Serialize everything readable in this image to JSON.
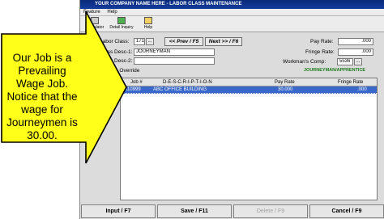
{
  "window": {
    "title": "YOUR COMPANY NAME HERE  -  LABOR CLASS MAINTENANCE"
  },
  "menu": [
    "Feature",
    "Help"
  ],
  "toolbar": [
    {
      "label": "Calculator",
      "icon": "calculator-icon"
    },
    {
      "label": "Detail Inquiry",
      "icon": "detail-inquiry-icon"
    },
    {
      "label": "Help",
      "icon": "help-icon"
    }
  ],
  "form": {
    "labor_class_label": "Labor Class:",
    "labor_class_value": "171",
    "lookup_button": "...",
    "prev_button": "<< Prev / F5",
    "next_button": "Next >> / F6",
    "desc1_label": "Class Desc-1:",
    "desc1_value": "JOURNEYMAN",
    "desc2_label": "Class Desc-2:",
    "desc2_value": "",
    "force_override_label": "Force Override",
    "pay_rate_label": "Pay Rate:",
    "pay_rate_value": ".000",
    "fringe_rate_label": "Fringe Rate:",
    "fringe_rate_value": ".000",
    "workmans_comp_label": "Workman's Comp:",
    "workmans_comp_value": "5536",
    "workmans_comp_button": "...",
    "category": "JOURNEYMAN/APPRENTICE"
  },
  "grid": {
    "columns": [
      "Job #",
      "D-E-S-C-R-I-P-T-I-O-N",
      "Pay Rate",
      "Fringe Rate"
    ],
    "rows": [
      {
        "job": "A10999",
        "description": "ABC OFFICE BUILDING",
        "pay_rate": "30.000",
        "fringe_rate": ".000"
      }
    ]
  },
  "buttons": {
    "input": "Input / F7",
    "save": "Save / F11",
    "delete": "Delete / F9",
    "cancel": "Cancel / F9"
  },
  "callout": {
    "text": "Our Job is a Prevailing Wage Job. Notice that the wage for Journeymen is 30.00.",
    "fill_color": "#ffff1a"
  }
}
